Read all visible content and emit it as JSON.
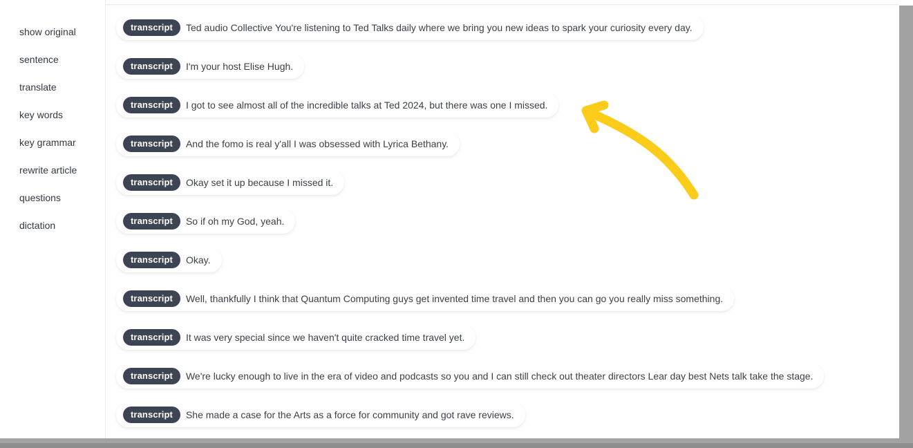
{
  "sidebar": {
    "items": [
      {
        "label": "show original"
      },
      {
        "label": "sentence"
      },
      {
        "label": "translate"
      },
      {
        "label": "key words"
      },
      {
        "label": "key grammar"
      },
      {
        "label": "rewrite article"
      },
      {
        "label": "questions"
      },
      {
        "label": "dictation"
      }
    ]
  },
  "transcript": {
    "rows": [
      {
        "tag": "transcript",
        "text": "Ted audio Collective You're listening to Ted Talks daily where we bring you new ideas to spark your curiosity every day."
      },
      {
        "tag": "transcript",
        "text": "I'm your host Elise Hugh."
      },
      {
        "tag": "transcript",
        "text": "I got to see almost all of the incredible talks at Ted 2024, but there was one I missed."
      },
      {
        "tag": "transcript",
        "text": "And the fomo is real y'all I was obsessed with Lyrica Bethany."
      },
      {
        "tag": "transcript",
        "text": "Okay set it up because I missed it."
      },
      {
        "tag": "transcript",
        "text": "So if oh my God, yeah."
      },
      {
        "tag": "transcript",
        "text": "Okay."
      },
      {
        "tag": "transcript",
        "text": "Well, thankfully I think that Quantum Computing guys get invented time travel and then you can go you really miss something."
      },
      {
        "tag": "transcript",
        "text": "It was very special since we haven't quite cracked time travel yet."
      },
      {
        "tag": "transcript",
        "text": "We're lucky enough to live in the era of video and podcasts so you and I can still check out theater directors Lear day best Nets talk take the stage."
      },
      {
        "tag": "transcript",
        "text": "She made a case for the Arts as a force for community and got rave reviews."
      }
    ]
  },
  "colors": {
    "badge_bg": "#3d4452",
    "annotation_arrow": "#fccc1a",
    "gutter": "#a3a3a3"
  },
  "annotation": {
    "icon": "arrow-pointer-icon"
  }
}
